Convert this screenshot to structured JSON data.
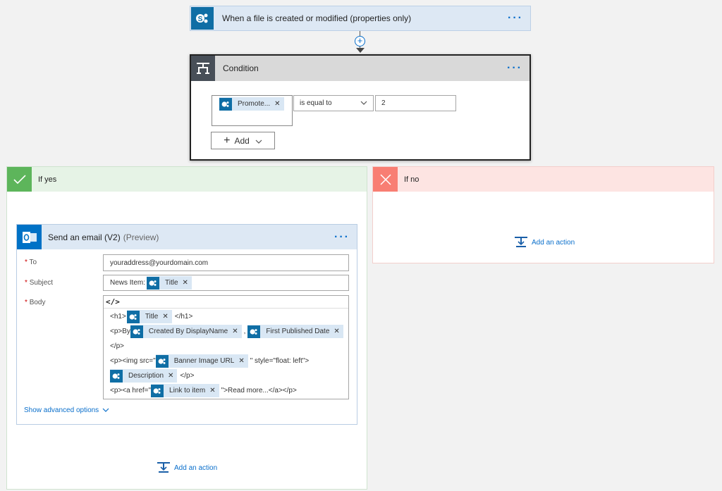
{
  "trigger": {
    "title": "When a file is created or modified (properties only)",
    "icon": "sharepoint-icon"
  },
  "condition": {
    "title": "Condition",
    "token": "Promote...",
    "operator": "is equal to",
    "value": "2",
    "add_label": "Add"
  },
  "if_yes": {
    "label": "If yes",
    "color": "#5db55b",
    "add_action": "Add an action"
  },
  "if_no": {
    "label": "If no",
    "color": "#f87e73",
    "add_action": "Add an action"
  },
  "email": {
    "title": "Send an email (V2)",
    "preview": "(Preview)",
    "to_label": "To",
    "to_value": "youraddress@yourdomain.com",
    "subject_label": "Subject",
    "subject_prefix": "News Item:",
    "subject_token": "Title",
    "body_label": "Body",
    "code_toggle": "</>",
    "body": {
      "h1_open": "<h1>",
      "title_token": "Title",
      "h1_close": "</h1>",
      "p_by": "<p>By",
      "created_by_token": "Created By DisplayName",
      "comma": ",",
      "published_token": "First Published Date",
      "p_close": "</p>",
      "img_open": "<p><img src=\"",
      "banner_token": "Banner Image URL",
      "img_close": "\" style=\"float: left\">",
      "description_token": "Description",
      "desc_close": "</p>",
      "a_open": "<p><a href=\"",
      "link_token": "Link to item",
      "a_close": "\">Read more...</a></p>"
    },
    "advanced": "Show advanced options"
  },
  "colors": {
    "accent": "#0a6fcb",
    "sharepoint": "#0f6ea5",
    "outlook": "#0072c6",
    "token_bg": "#d9e7f4",
    "header_blue": "#dde8f4"
  }
}
